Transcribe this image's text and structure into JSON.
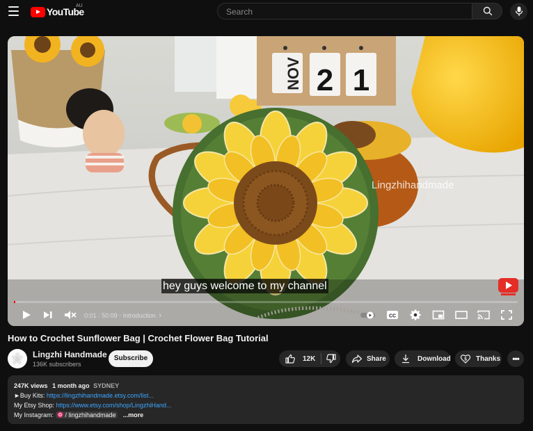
{
  "header": {
    "logo_text": "YouTube",
    "country": "AU",
    "search_placeholder": "Search",
    "icons": [
      "menu-icon",
      "search-icon",
      "mic-icon"
    ]
  },
  "player": {
    "calendar": [
      "NOV",
      "2",
      "1"
    ],
    "watermark": "Lingzhihandmade",
    "caption": "hey guys welcome to my channel",
    "current_time": "0:01",
    "duration": "50:09",
    "chapter": "Introduction",
    "progress": 0.003,
    "controls": [
      "play-icon",
      "next-icon",
      "mute-icon",
      "autoplay-toggle",
      "cc-icon",
      "settings-icon",
      "miniplayer-icon",
      "theater-icon",
      "cast-icon",
      "fullscreen-icon"
    ]
  },
  "video": {
    "title": "How to Crochet Sunflower Bag | Crochet Flower Bag Tutorial",
    "channel_name": "Lingzhi Handmade",
    "subscribers": "136K subscribers",
    "subscribe_label": "Subscribe",
    "likes": "12K",
    "share_label": "Share",
    "download_label": "Download",
    "thanks_label": "Thanks"
  },
  "description": {
    "views": "247K views",
    "age": "1 month ago",
    "location": "SYDNEY",
    "line1_label": "►Buy Kits: ",
    "line1_link": "https://lingzhihandmade.etsy.com/list...",
    "line2_label": "My Etsy Shop: ",
    "line2_link": "https://www.etsy.com/shop/LingzhiHand...",
    "line3_label": "My Instagram: ",
    "line3_tag": "/ lingzhihandmade",
    "more_label": "...more"
  },
  "colors": {
    "background": "#0f0f0f",
    "brand_red": "#ff0000",
    "link": "#3ea6ff",
    "pill": "#272727"
  }
}
